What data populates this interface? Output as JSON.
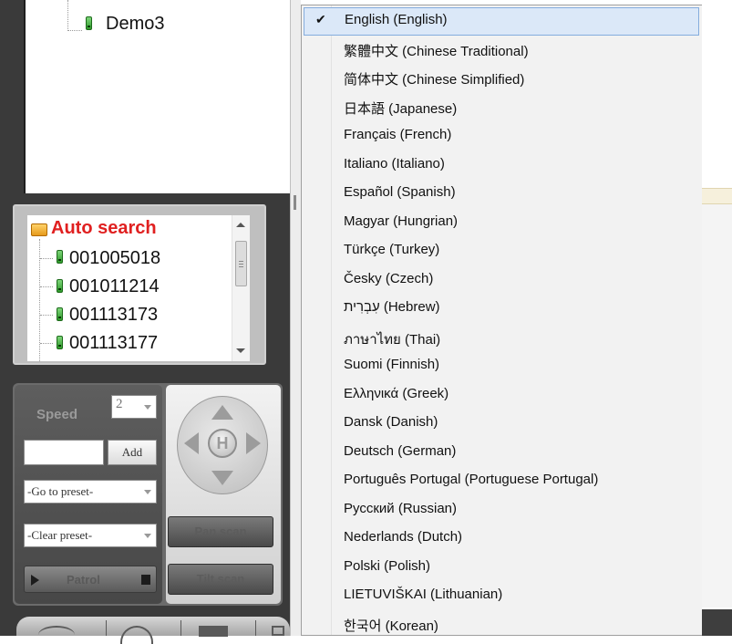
{
  "device_tree": {
    "device_name": "Demo3"
  },
  "auto_search": {
    "title": "Auto search",
    "items": [
      "001005018",
      "001011214",
      "001113173",
      "001113177"
    ]
  },
  "ptz": {
    "speed_label": "Speed",
    "speed_value": "2",
    "add_label": "Add",
    "go_to_preset": "-Go to preset-",
    "clear_preset": "-Clear preset-",
    "patrol_label": "Patrol",
    "pan_scan_label": "Pan scan",
    "tilt_scan_label": "Tilt scan",
    "home_label": "H"
  },
  "language_menu": {
    "selected": "English (English)",
    "items": [
      "English (English)",
      "繁體中文 (Chinese Traditional)",
      "简体中文 (Chinese Simplified)",
      "日本語 (Japanese)",
      "Français (French)",
      "Italiano (Italiano)",
      "Español (Spanish)",
      "Magyar (Hungrian)",
      "Türkçe (Turkey)",
      "Česky (Czech)",
      "עִבְרִית (Hebrew)",
      "ภาษาไทย (Thai)",
      "Suomi (Finnish)",
      "Ελληνικά (Greek)",
      "Dansk (Danish)",
      "Deutsch (German)",
      "Português Portugal (Portuguese Portugal)",
      "Русский (Russian)",
      "Nederlands (Dutch)",
      "Polski (Polish)",
      "LIETUVIŠKAI (Lithuanian)",
      "한국어 (Korean)"
    ]
  },
  "colors": {
    "menu_background": "#f2f2f2",
    "menu_highlight": "#dbe8f8",
    "menu_highlight_border": "#84acdd",
    "auto_search_title": "#e02020",
    "panel_dark": "#3a3a3a",
    "device_icon": "#2f9a2a"
  }
}
